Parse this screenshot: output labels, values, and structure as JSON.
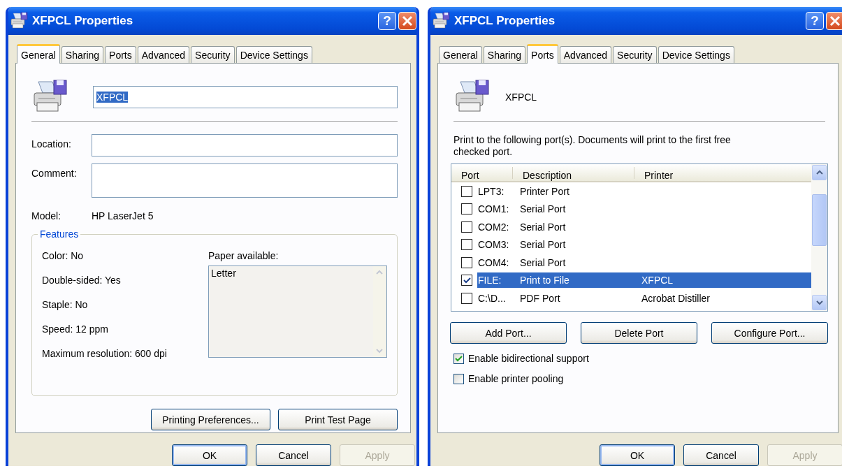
{
  "windows": [
    {
      "title": "XFPCL Properties",
      "help": "?",
      "tabs": [
        {
          "label": "General",
          "selected": true
        },
        {
          "label": "Sharing",
          "selected": false
        },
        {
          "label": "Ports",
          "selected": false
        },
        {
          "label": "Advanced",
          "selected": false
        },
        {
          "label": "Security",
          "selected": false
        },
        {
          "label": "Device Settings",
          "selected": false
        }
      ],
      "page": {
        "kind": "general",
        "name": {
          "value": "XFPCL",
          "highlighted": true
        },
        "fields": [
          {
            "label": "Location:",
            "kind": "single"
          },
          {
            "label": "Comment:",
            "kind": "multi"
          }
        ],
        "model": {
          "label": "Model:",
          "value": "HP LaserJet 5"
        },
        "features": {
          "title": "Features",
          "items": [
            "Color: No",
            "Double-sided: Yes",
            "Staple: No",
            "Speed: 12 ppm",
            "Maximum resolution: 600 dpi"
          ],
          "paper_label": "Paper available:",
          "paper": [
            "Letter"
          ]
        },
        "buttons": [
          "Printing Preferences...",
          "Print Test Page"
        ]
      },
      "buttons": [
        {
          "label": "OK",
          "default": true,
          "disabled": false
        },
        {
          "label": "Cancel",
          "default": false,
          "disabled": false
        },
        {
          "label": "Apply",
          "default": false,
          "disabled": true
        }
      ]
    },
    {
      "title": "XFPCL Properties",
      "help": "?",
      "tabs": [
        {
          "label": "General",
          "selected": false
        },
        {
          "label": "Sharing",
          "selected": false
        },
        {
          "label": "Ports",
          "selected": true
        },
        {
          "label": "Advanced",
          "selected": false
        },
        {
          "label": "Security",
          "selected": false
        },
        {
          "label": "Device Settings",
          "selected": false
        }
      ],
      "page": {
        "kind": "ports",
        "printer_name": "XFPCL",
        "instruction": "Print to the following port(s). Documents will print to the first free checked port.",
        "columns": [
          "Port",
          "Description",
          "Printer"
        ],
        "rows": [
          {
            "port": "LPT3:",
            "description": "Printer Port",
            "checked": false,
            "selected": false
          },
          {
            "port": "COM1:",
            "description": "Serial Port",
            "checked": false,
            "selected": false
          },
          {
            "port": "COM2:",
            "description": "Serial Port",
            "checked": false,
            "selected": false
          },
          {
            "port": "COM3:",
            "description": "Serial Port",
            "checked": false,
            "selected": false
          },
          {
            "port": "COM4:",
            "description": "Serial Port",
            "checked": false,
            "selected": false
          },
          {
            "port": "FILE:",
            "description": "Print to File",
            "printer": "XFPCL",
            "checked": true,
            "selected": true
          },
          {
            "port": "C:\\D...",
            "description": "PDF Port",
            "printer": "Acrobat Distiller",
            "checked": false,
            "selected": false
          }
        ],
        "buttons": [
          "Add Port...",
          "Delete Port",
          "Configure Port..."
        ],
        "options": [
          {
            "label": "Enable bidirectional support",
            "checked": true
          },
          {
            "label": "Enable printer pooling",
            "checked": false
          }
        ]
      },
      "buttons": [
        {
          "label": "OK",
          "default": true,
          "disabled": false
        },
        {
          "label": "Cancel",
          "default": false,
          "disabled": false
        },
        {
          "label": "Apply",
          "default": false,
          "disabled": true
        }
      ]
    }
  ]
}
